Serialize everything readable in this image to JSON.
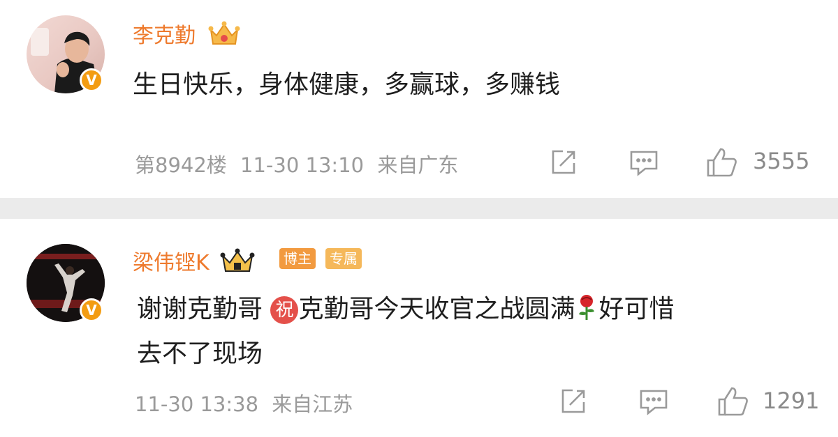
{
  "comments": [
    {
      "avatar": "avatar-man-pink-background",
      "verified_mark": "V",
      "username": "李克勤",
      "badge_icon": "crown-icon",
      "text": "生日快乐，身体健康，多赢球，多赚钱",
      "floor": "第8942楼",
      "time": "11-30 13:10",
      "location": "来自广东",
      "likes": "3555"
    },
    {
      "avatar": "avatar-athlete-dark-background",
      "verified_mark": "V",
      "username": "梁伟铿K",
      "badge_icon": "crown-icon",
      "tags": [
        "博主",
        "专属"
      ],
      "text_line1_a": "谢谢克勤哥",
      "wish_icon_label": "祝",
      "text_line1_b": "克勤哥今天收官之战圆满",
      "rose_icon": "rose-icon",
      "text_line1_c": "好可惜",
      "text_line2": "去不了现场",
      "time": "11-30 13:38",
      "location": "来自江苏",
      "likes": "1291"
    }
  ],
  "colors": {
    "username": "#ee7a2d",
    "separator": "#ebebeb",
    "meta": "#9a9a9a",
    "verified_badge": "#f39c12"
  }
}
